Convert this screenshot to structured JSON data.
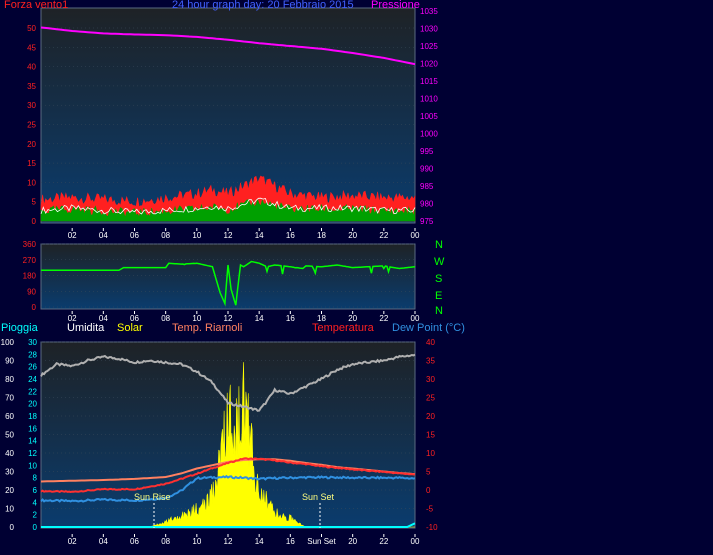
{
  "header": {
    "wind_label": "Forza vento1",
    "title": "24 hour graph day:  20 Febbraio 2015",
    "pressure_label": "Pressione"
  },
  "legend": {
    "rain": "Pioggia",
    "humidity": "Umidita",
    "solar": "Solar",
    "temp_roof": "Temp. Riarnoli",
    "temperature": "Temperatura",
    "dewpoint": "Dew Point (°C)"
  },
  "annotations": {
    "sunrise": "Sun Rise",
    "sunset": "Sun Set",
    "sunset_tick": "Sun Set"
  },
  "compass": [
    "N",
    "W",
    "S",
    "E",
    "N"
  ],
  "colors": {
    "background": "#000033",
    "plot_top": "#1e2226",
    "plot_bottom": "#0a3c6e",
    "wind_gust": "#ff2020",
    "wind_avg": "#00a000",
    "wind_dir": "#00ff00",
    "pressure": "#ff00ff",
    "humidity": "#b0b0b0",
    "solar": "#ffff00",
    "temperature": "#ff3030",
    "temp_roof": "#ff8060",
    "dewpoint": "#3090e0",
    "rain": "#00ffff"
  },
  "chart_data": [
    {
      "type": "line",
      "title": "24 hour graph day:  20 Febbraio 2015",
      "x_ticks": [
        "02",
        "04",
        "06",
        "08",
        "10",
        "12",
        "14",
        "16",
        "18",
        "20",
        "22",
        "00"
      ],
      "ylabel_left": "Forza vento1",
      "ylim_left": [
        0,
        50
      ],
      "yticks_left": [
        0,
        5,
        10,
        15,
        20,
        25,
        30,
        35,
        40,
        45,
        50
      ],
      "ylabel_right": "Pressione",
      "ylim_right": [
        975,
        1035
      ],
      "yticks_right": [
        975,
        980,
        985,
        990,
        995,
        1000,
        1005,
        1010,
        1015,
        1020,
        1025,
        1030,
        1035
      ],
      "series": [
        {
          "name": "Pressione",
          "axis": "right",
          "hours": [
            0,
            2,
            4,
            6,
            8,
            10,
            12,
            14,
            16,
            18,
            20,
            22,
            24
          ],
          "values": [
            1030.3,
            1029.3,
            1028.6,
            1028.3,
            1028.1,
            1027.6,
            1026.8,
            1025.8,
            1025.0,
            1024.2,
            1023.0,
            1021.6,
            1019.8
          ]
        },
        {
          "name": "Gust",
          "axis": "left",
          "hours": [
            0,
            2,
            4,
            6,
            8,
            10,
            11,
            12,
            13,
            14,
            15,
            16,
            18,
            20,
            22,
            24
          ],
          "values": [
            5.5,
            6,
            5.5,
            5,
            6,
            7,
            8,
            7,
            9,
            11,
            9,
            7,
            6,
            6.5,
            6,
            6
          ]
        },
        {
          "name": "Average",
          "axis": "left",
          "hours": [
            0,
            2,
            4,
            6,
            8,
            10,
            11,
            12,
            13,
            14,
            15,
            16,
            18,
            20,
            22,
            24
          ],
          "values": [
            2.5,
            3,
            2.5,
            2,
            2.5,
            3,
            3.5,
            3,
            4,
            5,
            4,
            3,
            3,
            3,
            2.5,
            2.5
          ]
        }
      ]
    },
    {
      "type": "line",
      "x_ticks": [
        "02",
        "04",
        "06",
        "08",
        "10",
        "12",
        "14",
        "16",
        "18",
        "20",
        "22",
        "00"
      ],
      "ylim": [
        0,
        360
      ],
      "yticks": [
        0,
        90,
        180,
        270,
        360
      ],
      "series": [
        {
          "name": "Direction",
          "hours": [
            0,
            5,
            5.3,
            8,
            8.2,
            9,
            10,
            11,
            11.5,
            11.8,
            12,
            12.2,
            12.5,
            12.8,
            13,
            13.5,
            14,
            14.5,
            15,
            16,
            16.8,
            17,
            18,
            19,
            20,
            21,
            22,
            23,
            24
          ],
          "values": [
            210,
            210,
            225,
            225,
            250,
            245,
            250,
            230,
            80,
            20,
            240,
            100,
            10,
            240,
            230,
            260,
            250,
            230,
            240,
            230,
            220,
            235,
            230,
            240,
            225,
            230,
            235,
            220,
            230
          ]
        }
      ]
    },
    {
      "type": "line",
      "x_ticks": [
        "02",
        "04",
        "06",
        "08",
        "10",
        "12",
        "14",
        "16",
        "Sun Set",
        "20",
        "22",
        "00"
      ],
      "ylabel_left": "Pioggia",
      "ylim_left": [
        0,
        100
      ],
      "yticks_left": [
        0,
        10,
        20,
        30,
        40,
        50,
        60,
        70,
        80,
        90,
        100
      ],
      "ylim_humidity_scale": [
        0,
        30
      ],
      "yticks_humidity_scale": [
        0,
        2,
        4,
        6,
        8,
        10,
        12,
        14,
        16,
        18,
        20,
        22,
        24,
        26,
        28,
        30
      ],
      "ylabel_right": "Temperatura",
      "ylim_right": [
        -10,
        40
      ],
      "yticks_right": [
        -10,
        -5,
        0,
        5,
        10,
        15,
        20,
        25,
        30,
        35,
        40
      ],
      "series": [
        {
          "name": "Umidita",
          "axis": "left",
          "hours": [
            0,
            1,
            2,
            3,
            4,
            5,
            6,
            7,
            8,
            9,
            10,
            11,
            12,
            12.5,
            13,
            14,
            14.5,
            15,
            16,
            17,
            18,
            19,
            20,
            21,
            22,
            23,
            24
          ],
          "values": [
            82,
            88,
            87,
            90,
            92,
            91,
            89,
            90,
            89,
            88,
            84,
            78,
            67,
            66,
            65,
            63,
            68,
            74,
            72,
            76,
            80,
            85,
            88,
            89,
            90,
            92,
            93
          ]
        },
        {
          "name": "Solar",
          "axis": "left",
          "hours": [
            0,
            7,
            8,
            9,
            10,
            10.5,
            11,
            11.5,
            12,
            12.5,
            13,
            13.5,
            14,
            14.5,
            15,
            15.5,
            16,
            16.5,
            17,
            18,
            24
          ],
          "values": [
            0,
            0,
            3,
            6,
            10,
            12,
            20,
            35,
            60,
            50,
            68,
            45,
            20,
            14,
            9,
            6,
            5,
            2,
            0,
            0,
            0
          ]
        },
        {
          "name": "Temperatura",
          "axis": "right",
          "hours": [
            0,
            2,
            4,
            6,
            8,
            9,
            10,
            11,
            12,
            13,
            14,
            15,
            16,
            17,
            18,
            19,
            20,
            21,
            22,
            23,
            24
          ],
          "values": [
            -0.3,
            -0.5,
            0.2,
            0.2,
            1.7,
            3.0,
            4.4,
            5.9,
            7.3,
            8.5,
            8.4,
            8.0,
            7.4,
            7.0,
            6.4,
            6.0,
            5.6,
            5.2,
            4.9,
            4.5,
            4.2
          ]
        },
        {
          "name": "Temp. Riarnoli",
          "axis": "right",
          "hours": [
            0,
            2,
            4,
            6,
            8,
            9,
            10,
            11,
            12,
            13,
            14,
            15,
            16,
            17,
            18,
            19,
            20,
            21,
            22,
            23,
            24
          ],
          "values": [
            2.3,
            2.5,
            2.7,
            3.0,
            3.5,
            4.5,
            5.8,
            6.7,
            7.6,
            8.1,
            8.3,
            8.3,
            7.9,
            7.3,
            6.8,
            6.2,
            5.8,
            5.4,
            5.0,
            4.6,
            4.3
          ]
        },
        {
          "name": "Dew Point (°C)",
          "axis": "right",
          "hours": [
            0,
            2,
            4,
            6,
            8,
            9,
            10,
            11,
            12,
            13,
            14,
            15,
            16,
            17,
            18,
            19,
            20,
            21,
            22,
            23,
            24
          ],
          "values": [
            -2.8,
            -3.0,
            -2.6,
            -2.8,
            -2.2,
            -0.2,
            3.2,
            3.4,
            3.5,
            3.3,
            3.0,
            3.2,
            3.3,
            3.4,
            3.4,
            3.4,
            3.3,
            3.3,
            3.3,
            3.3,
            3.1
          ]
        },
        {
          "name": "Pioggia",
          "axis": "left",
          "hours": [
            0,
            23.5,
            24
          ],
          "values": [
            0,
            0,
            2
          ]
        }
      ]
    }
  ]
}
